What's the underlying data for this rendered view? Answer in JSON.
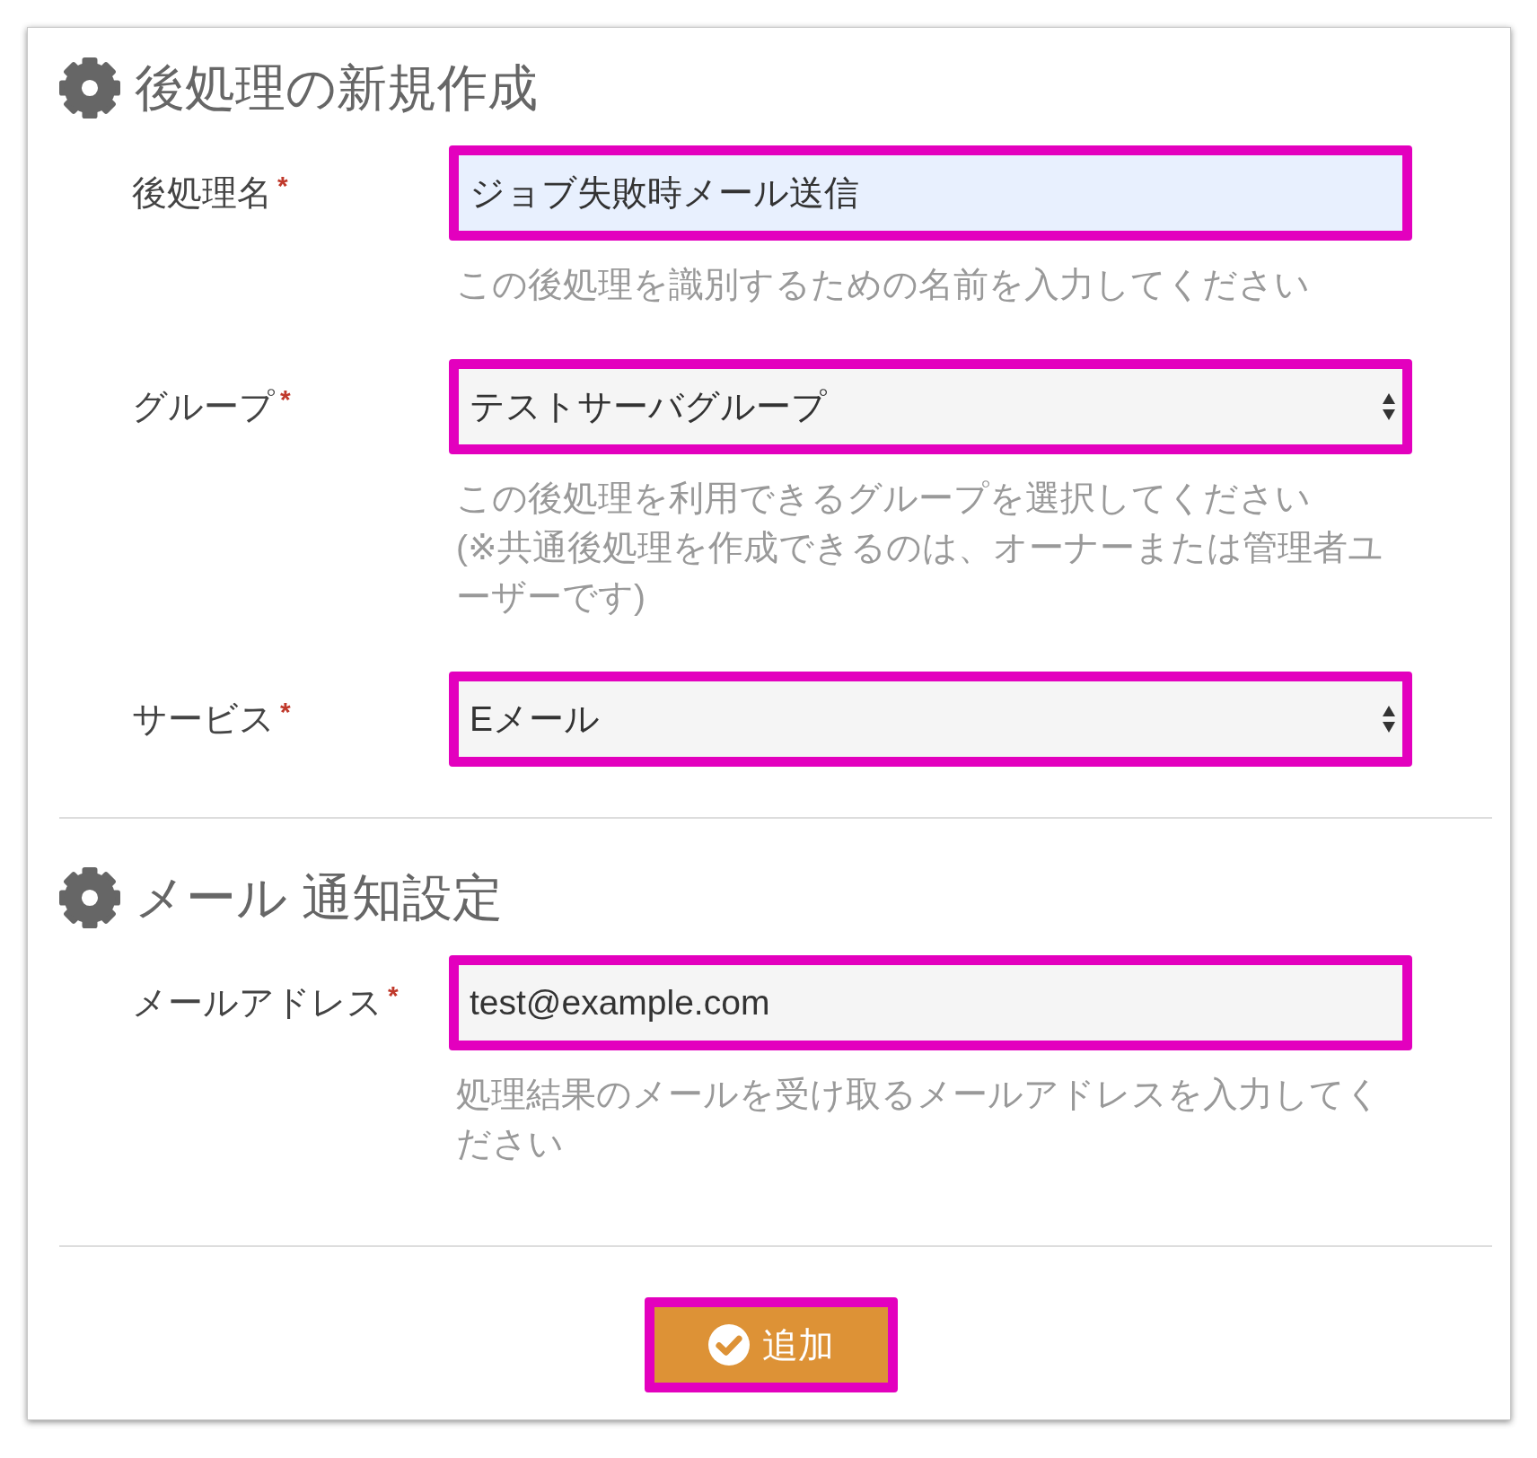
{
  "sections": [
    {
      "title": "後処理の新規作成",
      "fields": [
        {
          "kind": "text",
          "label": "後処理名",
          "required_mark": "*",
          "value": "ジョブ失敗時メール送信",
          "autofilled": true,
          "highlighted": true,
          "hints": [
            "この後処理を識別するための名前を入力してください"
          ]
        },
        {
          "kind": "select",
          "label": "グループ",
          "required_mark": "*",
          "value": "テストサーバグループ",
          "highlighted": true,
          "hints": [
            "この後処理を利用できるグループを選択してください",
            "(※共通後処理を作成できるのは、オーナーまたは管理者ユーザーです)"
          ]
        },
        {
          "kind": "select",
          "label": "サービス",
          "required_mark": "*",
          "value": "Eメール",
          "highlighted": true
        }
      ]
    },
    {
      "title": "メール 通知設定",
      "fields": [
        {
          "kind": "text",
          "label": "メールアドレス",
          "required_mark": "*",
          "value": "test@example.com",
          "autofilled": false,
          "highlighted": true,
          "hints": [
            "処理結果のメールを受け取るメールアドレスを入力してください"
          ]
        }
      ]
    }
  ],
  "submit": {
    "label": "追加",
    "highlighted": true
  }
}
